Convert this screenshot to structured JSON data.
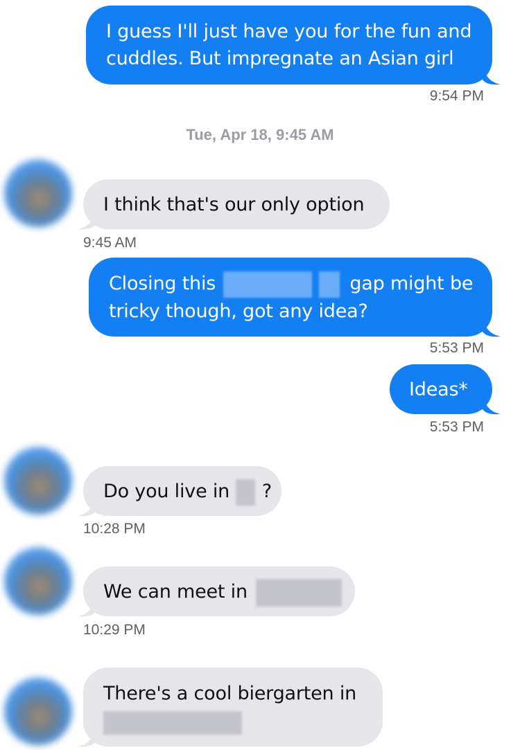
{
  "conversation": {
    "date_separator": "Tue, Apr 18, 9:45 AM",
    "messages": [
      {
        "direction": "outgoing",
        "lines": [
          "I guess I'll just have you for the fun and",
          "cuddles. But impregnate an Asian girl"
        ],
        "time": "9:54 PM"
      },
      {
        "direction": "incoming",
        "text": "I think that's our only option",
        "time": "9:45 AM"
      },
      {
        "direction": "outgoing",
        "text_before_redaction": "Closing this",
        "text_after_redaction": "gap might be",
        "second_line": "tricky though, got any idea?",
        "time": "5:53 PM"
      },
      {
        "direction": "outgoing",
        "text": "Ideas*",
        "time": "5:53 PM"
      },
      {
        "direction": "incoming",
        "text_before_redaction": "Do you live in",
        "text_after_redaction": "?",
        "time": "10:28 PM"
      },
      {
        "direction": "incoming",
        "text_before_redaction": "We can meet in",
        "time": "10:29 PM"
      },
      {
        "direction": "incoming",
        "first_line": "There's a cool biergarten in"
      }
    ]
  },
  "colors": {
    "outgoing_bubble": "#137ff2",
    "incoming_bubble": "#e5e5ea",
    "timestamp": "#5f5f66",
    "date_separator": "#9b9ba3"
  },
  "icons": {
    "avatar": "contact-avatar-blurred"
  }
}
